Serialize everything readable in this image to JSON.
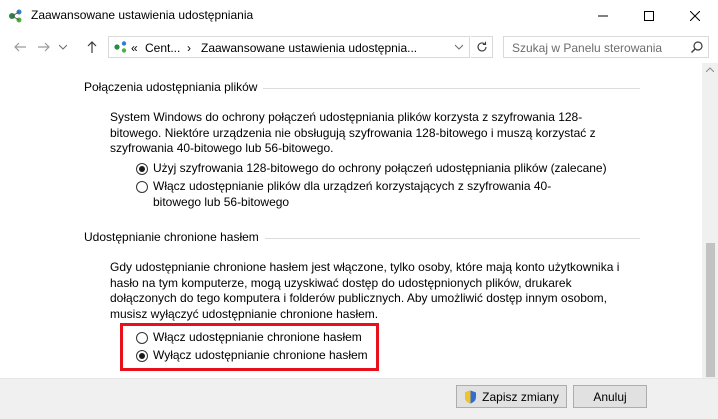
{
  "window": {
    "title": "Zaawansowane ustawienia udostępniania",
    "icons": {
      "app": "network-sharing-icon",
      "minimize": "minimize-icon",
      "maximize": "maximize-icon",
      "close": "close-icon"
    }
  },
  "nav": {
    "address": {
      "overflow": "«",
      "crumb1": "Cent...",
      "separator": "›",
      "crumb2": "Zaawansowane ustawienia udostępnia..."
    },
    "search_placeholder": "Szukaj w Panelu sterowania"
  },
  "sections": {
    "file_sharing": {
      "heading": "Połączenia udostępniania plików",
      "description": "System Windows do ochrony połączeń udostępniania plików korzysta z szyfrowania 128-bitowego. Niektóre urządzenia nie obsługują szyfrowania 128-bitowego i muszą korzystać z szyfrowania 40-bitowego lub 56-bitowego.",
      "options": [
        {
          "label": "Użyj szyfrowania 128-bitowego do ochrony połączeń udostępniania plików (zalecane)",
          "selected": true
        },
        {
          "label": "Włącz udostępnianie plików dla urządzeń korzystających z szyfrowania 40-bitowego lub 56-bitowego",
          "selected": false
        }
      ]
    },
    "password_protected": {
      "heading": "Udostępnianie chronione hasłem",
      "description": "Gdy udostępnianie chronione hasłem jest włączone, tylko osoby, które mają konto użytkownika i hasło na tym komputerze, mogą uzyskiwać dostęp do udostępnionych plików, drukarek dołączonych do tego komputera i folderów publicznych. Aby umożliwić dostęp innym osobom, musisz wyłączyć udostępnianie chronione hasłem.",
      "options": [
        {
          "label": "Włącz udostępnianie chronione hasłem",
          "selected": false
        },
        {
          "label": "Wyłącz udostępnianie chronione hasłem",
          "selected": true
        }
      ]
    }
  },
  "footer": {
    "save_label": "Zapisz zmiany",
    "cancel_label": "Anuluj"
  },
  "colors": {
    "highlight_border": "#e8101a",
    "footer_bg": "#f0f0f0"
  }
}
